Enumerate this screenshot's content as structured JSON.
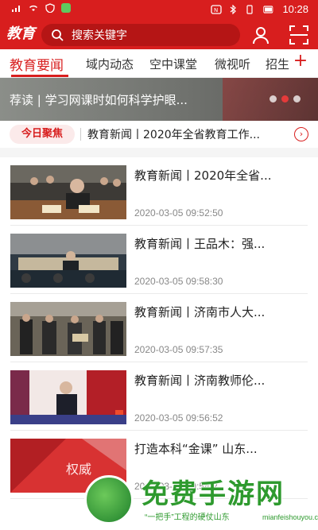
{
  "status_bar": {
    "time": "10:28"
  },
  "header": {
    "logo_text": "教育",
    "search_placeholder": "搜索关键字",
    "profile_icon": "person-icon",
    "scan_icon": "scan-icon"
  },
  "tabs": [
    {
      "label": "教育要闻",
      "active": true
    },
    {
      "label": "域内动态",
      "active": false
    },
    {
      "label": "空中课堂",
      "active": false
    },
    {
      "label": "微视听",
      "active": false
    },
    {
      "label": "招生",
      "active": false
    }
  ],
  "tab_add_label": "+",
  "banner": {
    "text": "荐读 | 学习网课时如何科学护眼..."
  },
  "focus": {
    "badge": "今日聚焦",
    "text": "教育新闻丨2020年全省教育工作...",
    "arrow": "›"
  },
  "news": [
    {
      "title": "教育新闻丨2020年全省...",
      "time": "2020-03-05 09:52:50"
    },
    {
      "title": "教育新闻丨王品木：强...",
      "time": "2020-03-05 09:58:30"
    },
    {
      "title": "教育新闻丨济南市人大...",
      "time": "2020-03-05 09:57:35"
    },
    {
      "title": "教育新闻丨济南教师伦...",
      "time": "2020-03-05 09:56:52"
    },
    {
      "title": "打造本科“金课”  山东...",
      "time": "2020-03-05 09:54:2"
    }
  ],
  "watermark": {
    "title": "免费手游网",
    "sub_text": "“一把手”工程的硬仗山东",
    "url": "mianfeishouyou.com"
  },
  "colors": {
    "brand_red": "#d81e1e"
  }
}
